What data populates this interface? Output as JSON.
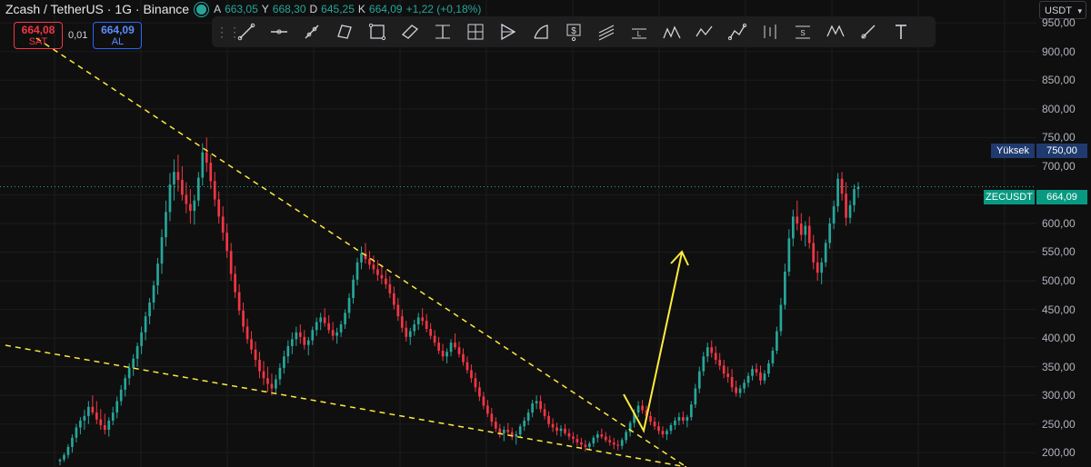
{
  "header": {
    "symbol": "Zcash / TetherUS · 1G · Binance",
    "ohlc": [
      {
        "k": "A",
        "v": "663,05"
      },
      {
        "k": "Y",
        "v": "668,30"
      },
      {
        "k": "D",
        "v": "645,25"
      },
      {
        "k": "K",
        "v": "664,09"
      }
    ],
    "change": "+1,22 (+0,18%)"
  },
  "trade": {
    "sell_price": "664,08",
    "sell_label": "SAT",
    "spread": "0,01",
    "buy_price": "664,09",
    "buy_label": "AL"
  },
  "axis": {
    "currency": "USDT",
    "ticks": [
      "950,00",
      "900,00",
      "850,00",
      "800,00",
      "750,00",
      "700,00",
      "650,00",
      "600,00",
      "550,00",
      "500,00",
      "450,00",
      "400,00",
      "350,00",
      "300,00",
      "250,00",
      "200,00"
    ],
    "high_name": "Yüksek",
    "high_value": "750,00",
    "last_name": "ZECUSDT",
    "last_value": "664,09"
  },
  "toolbar": {
    "tools": [
      "trend-line",
      "horizontal-ray",
      "cross-line",
      "parallel-channel",
      "rectangle",
      "rotated-rectangle",
      "fib-retracement",
      "gann-box",
      "pitchfork",
      "arc",
      "price-label",
      "trend-lines",
      "long-position",
      "elliott-wave",
      "xabcd-pattern",
      "path",
      "head-shoulders",
      "bars-pattern",
      "short-position",
      "triangle-pattern",
      "brush",
      "text"
    ]
  },
  "colors": {
    "background": "#0f0f0f",
    "up": "#26a69a",
    "down": "#f23645",
    "trendline": "#ffeb3b",
    "grid": "#1c1c1c"
  },
  "chart_data": {
    "type": "candlestick",
    "ylim": [
      175,
      990
    ],
    "price_axis_ticks": [
      950,
      900,
      850,
      800,
      750,
      700,
      650,
      600,
      550,
      500,
      450,
      400,
      350,
      300,
      250,
      200
    ],
    "last_price": 664.09,
    "high_line": 750,
    "candles_ohlc": [
      [
        185,
        190,
        178,
        188
      ],
      [
        188,
        200,
        184,
        196
      ],
      [
        196,
        215,
        190,
        210
      ],
      [
        210,
        232,
        200,
        226
      ],
      [
        226,
        250,
        218,
        244
      ],
      [
        244,
        262,
        232,
        256
      ],
      [
        256,
        275,
        240,
        264
      ],
      [
        264,
        290,
        250,
        280
      ],
      [
        280,
        300,
        266,
        270
      ],
      [
        270,
        290,
        250,
        258
      ],
      [
        258,
        276,
        240,
        248
      ],
      [
        248,
        268,
        232,
        240
      ],
      [
        240,
        262,
        228,
        256
      ],
      [
        256,
        280,
        248,
        270
      ],
      [
        270,
        298,
        260,
        290
      ],
      [
        290,
        318,
        282,
        310
      ],
      [
        310,
        336,
        298,
        330
      ],
      [
        330,
        356,
        318,
        348
      ],
      [
        348,
        372,
        334,
        364
      ],
      [
        364,
        392,
        350,
        386
      ],
      [
        386,
        420,
        372,
        410
      ],
      [
        410,
        446,
        396,
        438
      ],
      [
        438,
        470,
        424,
        462
      ],
      [
        462,
        500,
        450,
        492
      ],
      [
        492,
        540,
        476,
        530
      ],
      [
        530,
        590,
        512,
        576
      ],
      [
        576,
        640,
        560,
        620
      ],
      [
        620,
        688,
        604,
        668
      ],
      [
        668,
        712,
        640,
        690
      ],
      [
        690,
        720,
        656,
        676
      ],
      [
        676,
        700,
        640,
        650
      ],
      [
        650,
        672,
        618,
        634
      ],
      [
        634,
        660,
        600,
        622
      ],
      [
        622,
        650,
        598,
        640
      ],
      [
        640,
        690,
        630,
        680
      ],
      [
        680,
        740,
        666,
        724
      ],
      [
        724,
        750,
        690,
        706
      ],
      [
        706,
        720,
        660,
        674
      ],
      [
        674,
        690,
        630,
        642
      ],
      [
        642,
        656,
        600,
        612
      ],
      [
        612,
        630,
        570,
        584
      ],
      [
        584,
        600,
        540,
        552
      ],
      [
        552,
        566,
        500,
        512
      ],
      [
        512,
        526,
        470,
        480
      ],
      [
        480,
        494,
        440,
        448
      ],
      [
        448,
        462,
        410,
        420
      ],
      [
        420,
        434,
        390,
        398
      ],
      [
        398,
        412,
        372,
        380
      ],
      [
        380,
        394,
        350,
        362
      ],
      [
        362,
        376,
        330,
        342
      ],
      [
        342,
        360,
        318,
        330
      ],
      [
        330,
        350,
        306,
        320
      ],
      [
        320,
        338,
        300,
        312
      ],
      [
        312,
        336,
        302,
        328
      ],
      [
        328,
        356,
        318,
        348
      ],
      [
        348,
        378,
        338,
        368
      ],
      [
        368,
        396,
        356,
        386
      ],
      [
        386,
        410,
        372,
        398
      ],
      [
        398,
        420,
        386,
        410
      ],
      [
        410,
        424,
        390,
        402
      ],
      [
        402,
        414,
        380,
        388
      ],
      [
        388,
        402,
        370,
        396
      ],
      [
        396,
        420,
        388,
        414
      ],
      [
        414,
        436,
        404,
        428
      ],
      [
        428,
        444,
        414,
        436
      ],
      [
        436,
        452,
        420,
        426
      ],
      [
        426,
        440,
        408,
        414
      ],
      [
        414,
        428,
        396,
        404
      ],
      [
        404,
        418,
        390,
        410
      ],
      [
        410,
        430,
        402,
        424
      ],
      [
        424,
        450,
        416,
        444
      ],
      [
        444,
        478,
        434,
        470
      ],
      [
        470,
        510,
        460,
        502
      ],
      [
        502,
        540,
        492,
        532
      ],
      [
        532,
        560,
        520,
        548
      ],
      [
        548,
        566,
        530,
        538
      ],
      [
        538,
        552,
        520,
        528
      ],
      [
        528,
        544,
        512,
        520
      ],
      [
        520,
        536,
        500,
        510
      ],
      [
        510,
        528,
        494,
        504
      ],
      [
        504,
        518,
        486,
        494
      ],
      [
        494,
        508,
        470,
        478
      ],
      [
        478,
        490,
        450,
        458
      ],
      [
        458,
        470,
        430,
        438
      ],
      [
        438,
        450,
        410,
        418
      ],
      [
        418,
        430,
        394,
        402
      ],
      [
        402,
        418,
        388,
        412
      ],
      [
        412,
        432,
        404,
        424
      ],
      [
        424,
        444,
        414,
        436
      ],
      [
        436,
        452,
        422,
        430
      ],
      [
        430,
        442,
        410,
        416
      ],
      [
        416,
        426,
        398,
        404
      ],
      [
        404,
        414,
        386,
        392
      ],
      [
        392,
        402,
        372,
        378
      ],
      [
        378,
        390,
        360,
        368
      ],
      [
        368,
        382,
        356,
        376
      ],
      [
        376,
        398,
        368,
        392
      ],
      [
        392,
        408,
        380,
        384
      ],
      [
        384,
        394,
        366,
        372
      ],
      [
        372,
        382,
        352,
        358
      ],
      [
        358,
        368,
        338,
        344
      ],
      [
        344,
        354,
        322,
        330
      ],
      [
        330,
        340,
        306,
        314
      ],
      [
        314,
        324,
        290,
        298
      ],
      [
        298,
        306,
        276,
        282
      ],
      [
        282,
        292,
        262,
        268
      ],
      [
        268,
        278,
        246,
        254
      ],
      [
        254,
        262,
        236,
        242
      ],
      [
        242,
        250,
        226,
        234
      ],
      [
        234,
        246,
        220,
        240
      ],
      [
        240,
        252,
        232,
        236
      ],
      [
        236,
        244,
        222,
        228
      ],
      [
        228,
        238,
        214,
        232
      ],
      [
        232,
        250,
        226,
        246
      ],
      [
        246,
        262,
        238,
        256
      ],
      [
        256,
        276,
        248,
        270
      ],
      [
        270,
        292,
        262,
        286
      ],
      [
        286,
        300,
        276,
        290
      ],
      [
        290,
        300,
        270,
        276
      ],
      [
        276,
        286,
        258,
        264
      ],
      [
        264,
        272,
        244,
        250
      ],
      [
        250,
        260,
        236,
        244
      ],
      [
        244,
        252,
        230,
        238
      ],
      [
        238,
        248,
        228,
        242
      ],
      [
        242,
        250,
        230,
        234
      ],
      [
        234,
        242,
        222,
        228
      ],
      [
        228,
        236,
        216,
        224
      ],
      [
        224,
        232,
        212,
        218
      ],
      [
        218,
        226,
        206,
        214
      ],
      [
        214,
        222,
        202,
        210
      ],
      [
        210,
        220,
        204,
        216
      ],
      [
        216,
        230,
        210,
        226
      ],
      [
        226,
        238,
        218,
        232
      ],
      [
        232,
        242,
        224,
        228
      ],
      [
        228,
        236,
        218,
        222
      ],
      [
        222,
        230,
        212,
        218
      ],
      [
        218,
        226,
        206,
        214
      ],
      [
        214,
        222,
        204,
        212
      ],
      [
        212,
        226,
        206,
        222
      ],
      [
        222,
        240,
        216,
        236
      ],
      [
        236,
        256,
        228,
        252
      ],
      [
        252,
        276,
        244,
        270
      ],
      [
        270,
        290,
        262,
        282
      ],
      [
        282,
        292,
        268,
        274
      ],
      [
        274,
        282,
        258,
        264
      ],
      [
        264,
        272,
        248,
        254
      ],
      [
        254,
        262,
        240,
        246
      ],
      [
        246,
        254,
        232,
        238
      ],
      [
        238,
        246,
        226,
        232
      ],
      [
        232,
        242,
        222,
        238
      ],
      [
        238,
        252,
        232,
        248
      ],
      [
        248,
        262,
        240,
        256
      ],
      [
        256,
        270,
        248,
        262
      ],
      [
        262,
        272,
        250,
        256
      ],
      [
        256,
        266,
        244,
        262
      ],
      [
        262,
        290,
        256,
        284
      ],
      [
        284,
        320,
        278,
        312
      ],
      [
        312,
        350,
        304,
        342
      ],
      [
        342,
        376,
        334,
        368
      ],
      [
        368,
        392,
        358,
        384
      ],
      [
        384,
        396,
        366,
        374
      ],
      [
        374,
        386,
        354,
        362
      ],
      [
        362,
        374,
        344,
        352
      ],
      [
        352,
        362,
        330,
        338
      ],
      [
        338,
        350,
        322,
        332
      ],
      [
        332,
        346,
        306,
        314
      ],
      [
        314,
        326,
        298,
        304
      ],
      [
        304,
        318,
        296,
        312
      ],
      [
        312,
        328,
        304,
        322
      ],
      [
        322,
        340,
        314,
        334
      ],
      [
        334,
        352,
        326,
        346
      ],
      [
        346,
        356,
        334,
        340
      ],
      [
        340,
        352,
        318,
        326
      ],
      [
        326,
        344,
        320,
        338
      ],
      [
        338,
        362,
        332,
        356
      ],
      [
        356,
        384,
        350,
        378
      ],
      [
        378,
        420,
        372,
        412
      ],
      [
        412,
        470,
        404,
        458
      ],
      [
        458,
        530,
        450,
        516
      ],
      [
        516,
        590,
        508,
        574
      ],
      [
        574,
        624,
        560,
        612
      ],
      [
        612,
        640,
        588,
        600
      ],
      [
        600,
        618,
        570,
        580
      ],
      [
        580,
        604,
        560,
        596
      ],
      [
        596,
        612,
        556,
        566
      ],
      [
        566,
        580,
        520,
        532
      ],
      [
        532,
        552,
        500,
        514
      ],
      [
        514,
        540,
        494,
        532
      ],
      [
        532,
        572,
        524,
        566
      ],
      [
        566,
        610,
        556,
        600
      ],
      [
        600,
        640,
        590,
        630
      ],
      [
        630,
        688,
        620,
        678
      ],
      [
        678,
        690,
        640,
        652
      ],
      [
        652,
        672,
        596,
        610
      ],
      [
        610,
        640,
        600,
        632
      ],
      [
        632,
        668,
        620,
        660
      ],
      [
        660,
        672,
        645,
        664
      ]
    ]
  }
}
